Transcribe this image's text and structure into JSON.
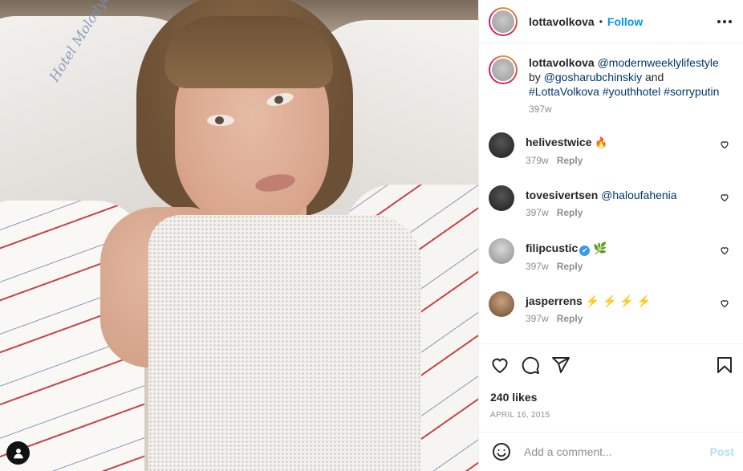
{
  "post": {
    "image": {
      "embroidery_text": "Hotel Molodyozhny",
      "user_tag_icon": "person-icon"
    },
    "header": {
      "username": "lottavolkova",
      "separator": "•",
      "follow_label": "Follow"
    },
    "caption": {
      "username": "lottavolkova",
      "mention1": "@modernweeklylifestyle",
      "by": "by",
      "mention2": "@gosharubchinskiy",
      "and": "and",
      "hashtag1": "#LottaVolkova",
      "hashtag2": "#youthhotel",
      "hashtag3": "#sorryputin",
      "time": "397w"
    },
    "comments": [
      {
        "username": "helivestwice",
        "text": "🔥",
        "time": "379w",
        "reply": "Reply"
      },
      {
        "username": "tovesivertsen",
        "text": "@haloufahenia",
        "time": "397w",
        "reply": "Reply"
      },
      {
        "username": "filipcustic",
        "verified": "✔",
        "text": "🌿",
        "time": "397w",
        "reply": "Reply"
      },
      {
        "username": "jasperrens",
        "text": "⚡ ⚡ ⚡ ⚡",
        "time": "397w",
        "reply": "Reply"
      }
    ],
    "actions": {
      "likes": "240 likes",
      "date": "APRIL 16, 2015"
    },
    "add_comment": {
      "placeholder": "Add a comment...",
      "post_label": "Post"
    }
  },
  "icons": [
    "heart-icon",
    "comment-icon",
    "share-icon",
    "bookmark-icon",
    "more-icon",
    "emoji-icon",
    "small-heart-icon"
  ]
}
